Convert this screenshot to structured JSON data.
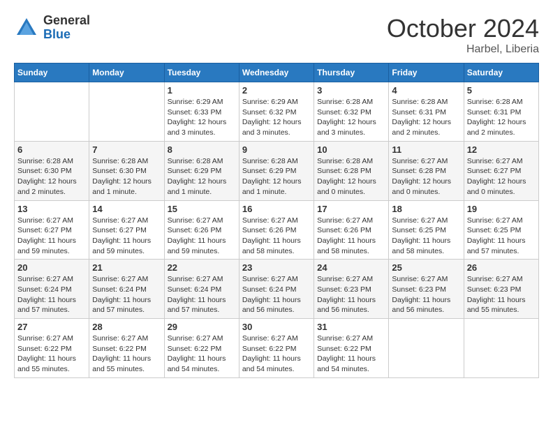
{
  "header": {
    "logo_general": "General",
    "logo_blue": "Blue",
    "month": "October 2024",
    "location": "Harbel, Liberia"
  },
  "days_of_week": [
    "Sunday",
    "Monday",
    "Tuesday",
    "Wednesday",
    "Thursday",
    "Friday",
    "Saturday"
  ],
  "weeks": [
    [
      {
        "day": "",
        "info": ""
      },
      {
        "day": "",
        "info": ""
      },
      {
        "day": "1",
        "info": "Sunrise: 6:29 AM\nSunset: 6:33 PM\nDaylight: 12 hours and 3 minutes."
      },
      {
        "day": "2",
        "info": "Sunrise: 6:29 AM\nSunset: 6:32 PM\nDaylight: 12 hours and 3 minutes."
      },
      {
        "day": "3",
        "info": "Sunrise: 6:28 AM\nSunset: 6:32 PM\nDaylight: 12 hours and 3 minutes."
      },
      {
        "day": "4",
        "info": "Sunrise: 6:28 AM\nSunset: 6:31 PM\nDaylight: 12 hours and 2 minutes."
      },
      {
        "day": "5",
        "info": "Sunrise: 6:28 AM\nSunset: 6:31 PM\nDaylight: 12 hours and 2 minutes."
      }
    ],
    [
      {
        "day": "6",
        "info": "Sunrise: 6:28 AM\nSunset: 6:30 PM\nDaylight: 12 hours and 2 minutes."
      },
      {
        "day": "7",
        "info": "Sunrise: 6:28 AM\nSunset: 6:30 PM\nDaylight: 12 hours and 1 minute."
      },
      {
        "day": "8",
        "info": "Sunrise: 6:28 AM\nSunset: 6:29 PM\nDaylight: 12 hours and 1 minute."
      },
      {
        "day": "9",
        "info": "Sunrise: 6:28 AM\nSunset: 6:29 PM\nDaylight: 12 hours and 1 minute."
      },
      {
        "day": "10",
        "info": "Sunrise: 6:28 AM\nSunset: 6:28 PM\nDaylight: 12 hours and 0 minutes."
      },
      {
        "day": "11",
        "info": "Sunrise: 6:27 AM\nSunset: 6:28 PM\nDaylight: 12 hours and 0 minutes."
      },
      {
        "day": "12",
        "info": "Sunrise: 6:27 AM\nSunset: 6:27 PM\nDaylight: 12 hours and 0 minutes."
      }
    ],
    [
      {
        "day": "13",
        "info": "Sunrise: 6:27 AM\nSunset: 6:27 PM\nDaylight: 11 hours and 59 minutes."
      },
      {
        "day": "14",
        "info": "Sunrise: 6:27 AM\nSunset: 6:27 PM\nDaylight: 11 hours and 59 minutes."
      },
      {
        "day": "15",
        "info": "Sunrise: 6:27 AM\nSunset: 6:26 PM\nDaylight: 11 hours and 59 minutes."
      },
      {
        "day": "16",
        "info": "Sunrise: 6:27 AM\nSunset: 6:26 PM\nDaylight: 11 hours and 58 minutes."
      },
      {
        "day": "17",
        "info": "Sunrise: 6:27 AM\nSunset: 6:26 PM\nDaylight: 11 hours and 58 minutes."
      },
      {
        "day": "18",
        "info": "Sunrise: 6:27 AM\nSunset: 6:25 PM\nDaylight: 11 hours and 58 minutes."
      },
      {
        "day": "19",
        "info": "Sunrise: 6:27 AM\nSunset: 6:25 PM\nDaylight: 11 hours and 57 minutes."
      }
    ],
    [
      {
        "day": "20",
        "info": "Sunrise: 6:27 AM\nSunset: 6:24 PM\nDaylight: 11 hours and 57 minutes."
      },
      {
        "day": "21",
        "info": "Sunrise: 6:27 AM\nSunset: 6:24 PM\nDaylight: 11 hours and 57 minutes."
      },
      {
        "day": "22",
        "info": "Sunrise: 6:27 AM\nSunset: 6:24 PM\nDaylight: 11 hours and 57 minutes."
      },
      {
        "day": "23",
        "info": "Sunrise: 6:27 AM\nSunset: 6:24 PM\nDaylight: 11 hours and 56 minutes."
      },
      {
        "day": "24",
        "info": "Sunrise: 6:27 AM\nSunset: 6:23 PM\nDaylight: 11 hours and 56 minutes."
      },
      {
        "day": "25",
        "info": "Sunrise: 6:27 AM\nSunset: 6:23 PM\nDaylight: 11 hours and 56 minutes."
      },
      {
        "day": "26",
        "info": "Sunrise: 6:27 AM\nSunset: 6:23 PM\nDaylight: 11 hours and 55 minutes."
      }
    ],
    [
      {
        "day": "27",
        "info": "Sunrise: 6:27 AM\nSunset: 6:22 PM\nDaylight: 11 hours and 55 minutes."
      },
      {
        "day": "28",
        "info": "Sunrise: 6:27 AM\nSunset: 6:22 PM\nDaylight: 11 hours and 55 minutes."
      },
      {
        "day": "29",
        "info": "Sunrise: 6:27 AM\nSunset: 6:22 PM\nDaylight: 11 hours and 54 minutes."
      },
      {
        "day": "30",
        "info": "Sunrise: 6:27 AM\nSunset: 6:22 PM\nDaylight: 11 hours and 54 minutes."
      },
      {
        "day": "31",
        "info": "Sunrise: 6:27 AM\nSunset: 6:22 PM\nDaylight: 11 hours and 54 minutes."
      },
      {
        "day": "",
        "info": ""
      },
      {
        "day": "",
        "info": ""
      }
    ]
  ]
}
